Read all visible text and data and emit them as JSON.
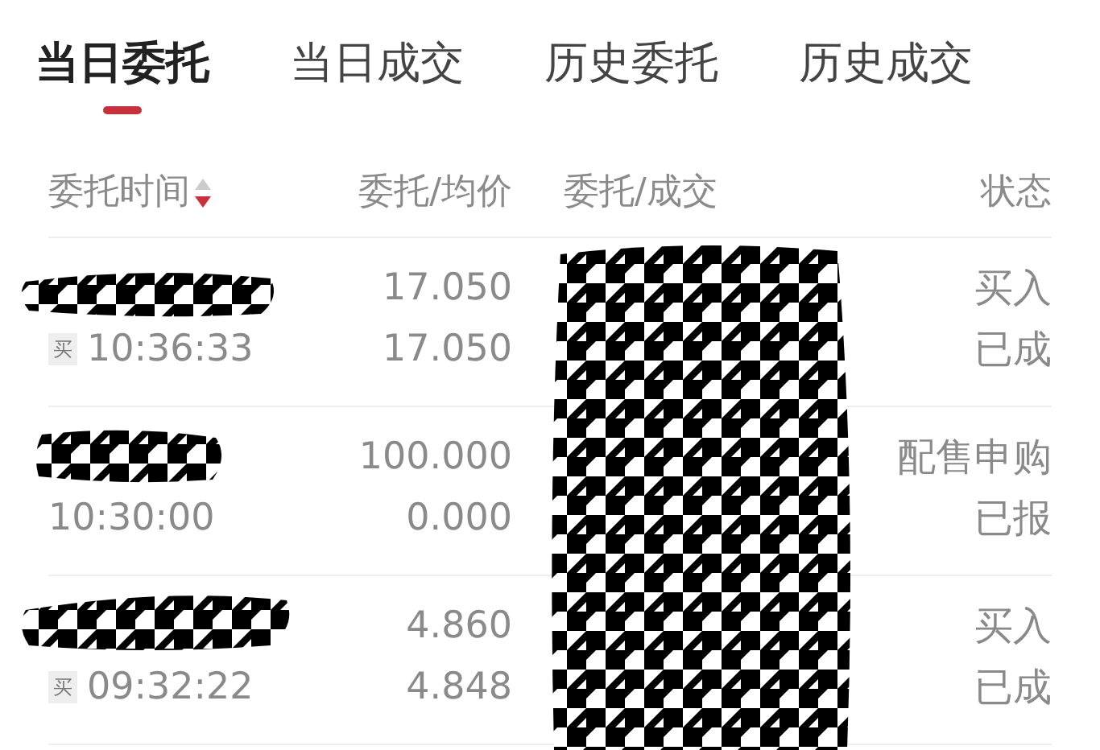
{
  "tabs": [
    {
      "label": "当日委托",
      "selected": true
    },
    {
      "label": "当日成交",
      "selected": false
    },
    {
      "label": "历史委托",
      "selected": false
    },
    {
      "label": "历史成交",
      "selected": false
    }
  ],
  "table": {
    "columns": [
      {
        "label": "委托时间",
        "sorted_descending": true
      },
      {
        "label": "委托/均价"
      },
      {
        "label": "委托/成交"
      },
      {
        "label": "状态"
      }
    ],
    "rows": [
      {
        "side": "买",
        "time": "10:36:33",
        "order_price": "17.050",
        "avg_price": "17.050",
        "status": [
          "买入",
          "已成"
        ]
      },
      {
        "time": "10:30:00",
        "order_price": "100.000",
        "avg_price": "0.000",
        "status": [
          "配售申购",
          "已报"
        ]
      },
      {
        "side": "买",
        "time": "09:32:22",
        "order_price": "4.860",
        "avg_price": "4.848",
        "status": [
          "买入",
          "已成"
        ]
      }
    ]
  }
}
